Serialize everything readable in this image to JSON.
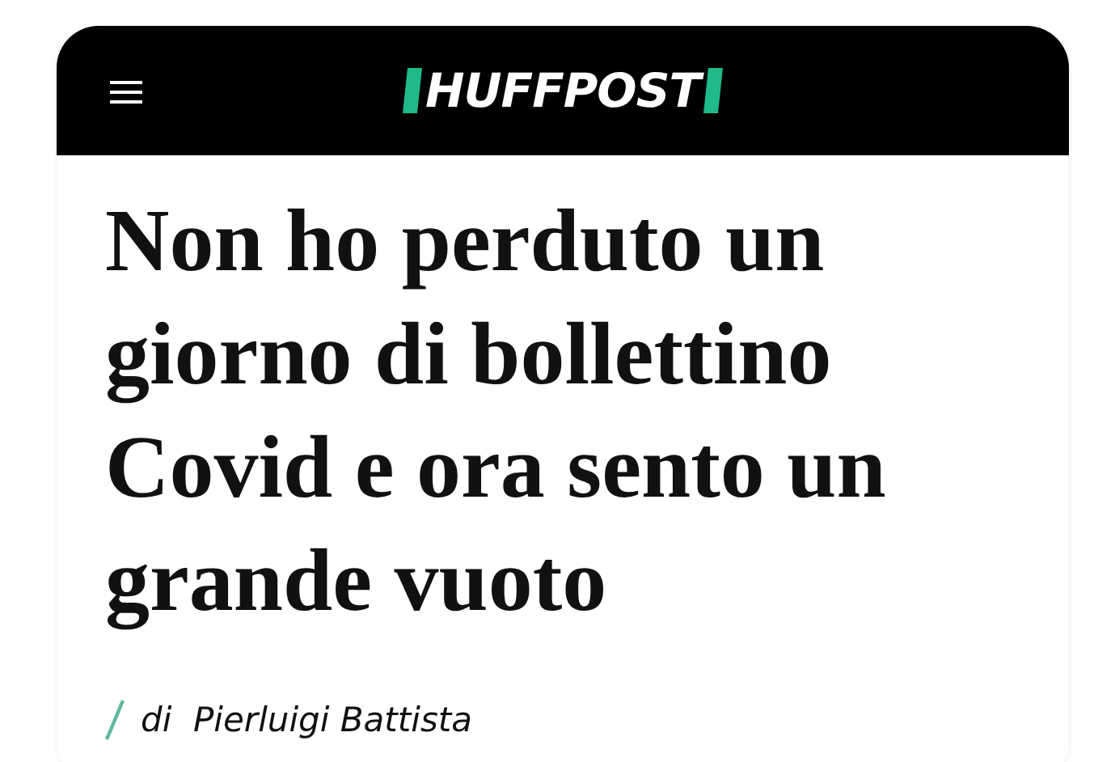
{
  "header": {
    "logo": "HUFFPOST"
  },
  "article": {
    "headline": "Non ho perduto un giorno di bollettino Covid e ora sento un grande vuoto",
    "byline": "di  Pierluigi Battista"
  }
}
